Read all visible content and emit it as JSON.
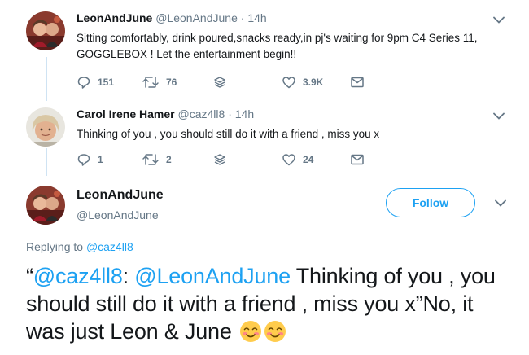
{
  "tweets": [
    {
      "name": "LeonAndJune",
      "handle": "@LeonAndJune",
      "separator": "·",
      "time": "14h",
      "text": "Sitting comfortably, drink poured,snacks ready,in pj's waiting for 9pm C4 Series 11, GOGGLEBOX ! Let the entertainment begin!!",
      "replies": "151",
      "retweets": "76",
      "likes": "3.9K"
    },
    {
      "name": "Carol Irene Hamer",
      "handle": "@caz4ll8",
      "separator": "·",
      "time": "14h",
      "text": "Thinking of you , you should still do it with a friend , miss you x",
      "replies": "1",
      "retweets": "2",
      "likes": "24"
    }
  ],
  "main": {
    "name": "LeonAndJune",
    "handle": "@LeonAndJune",
    "follow_label": "Follow",
    "replying_prefix": "Replying to ",
    "replying_to": "@caz4ll8",
    "text_open": "“",
    "mention1": "@caz4ll8",
    "colon": ": ",
    "mention2": "@LeonAndJune",
    "text_rest": " Thinking of you , you should still do it with a friend , miss you x”No, it was just Leon & June"
  },
  "icons": {
    "reply": "reply-icon",
    "retweet": "retweet-icon",
    "stack": "stack-icon",
    "like": "heart-icon",
    "dm": "envelope-icon",
    "more": "chevron-down-icon",
    "emoji": "smiling-face-with-blush-emoji"
  },
  "colors": {
    "accent": "#1da1f2",
    "secondary_text": "#657786",
    "primary_text": "#14171a",
    "thread_line": "#cfe3f3"
  }
}
